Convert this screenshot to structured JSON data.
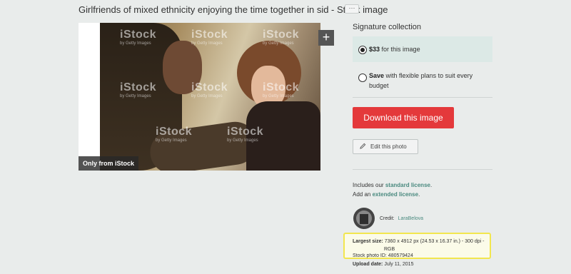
{
  "header": {
    "title": "Girlfriends of mixed ethnicity enjoying the time together in sid - Stock image",
    "more_label": "···"
  },
  "image": {
    "plus_label": "+",
    "badge": "Only from iStock",
    "watermark_text": "iStock",
    "watermark_sub": "by Getty Images"
  },
  "purchase": {
    "collection_title": "Signature collection",
    "option1": {
      "price": "$33",
      "text": "for this image",
      "selected": true
    },
    "option2": {
      "bold": "Save",
      "text": "with flexible plans to suit every budget",
      "selected": false
    },
    "download_label": "Download this image",
    "edit_label": "Edit this photo"
  },
  "license": {
    "line1_prefix": "Includes our",
    "line1_link": "standard license",
    "line1_suffix": ".",
    "line2_prefix": "Add an",
    "line2_link": "extended license",
    "line2_suffix": "."
  },
  "credit": {
    "label": "Credit:",
    "name": "LaraBelova"
  },
  "details": {
    "size_label": "Largest size:",
    "size_value": "7360 x 4912 px (24.53 x 16.37 in.) - 300 dpi -",
    "size_mode": "RGB",
    "stock_id": "Stock photo ID: 480579424",
    "upload_label": "Upload date:",
    "upload_value": "July 11, 2015"
  },
  "colors": {
    "accent_red": "#e4393b",
    "link_teal": "#4a8a7f",
    "highlight": "#f2e64e",
    "selected_bg": "#dce9e6"
  }
}
